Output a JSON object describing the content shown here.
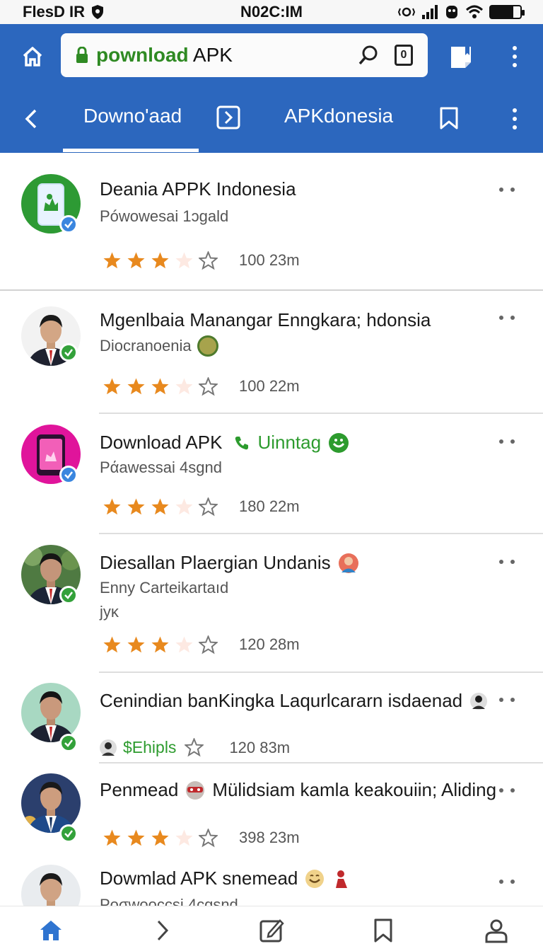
{
  "status_bar": {
    "left_text": "FlesD IR",
    "center_text": "N02C:IM",
    "battery_level": 0.75
  },
  "browser": {
    "url_accent": "pownload",
    "url_rest": " APK",
    "tab_count": "0"
  },
  "tabs": {
    "download_label": "Downo'aad",
    "apk_label": "APKdonesia"
  },
  "colors": {
    "toolbar": "#2c67be",
    "star_filled": "#e8891e",
    "verified_green": "#33a13a",
    "verified_blue": "#3a86df",
    "text_green": "#2d9b2e"
  },
  "items": [
    {
      "title": "Deania APPK Indonesia",
      "subtitle": "Pówowesai 1ɔgald",
      "rating_count": "100 23m",
      "stars": 3
    },
    {
      "title": "Mgenlbaia Manangar Enngkara; hdonsia",
      "subtitle": "Diocranoenia",
      "rating_count": "100 22m",
      "stars": 3
    },
    {
      "title": "Download APK",
      "title_extra": "Uinntag",
      "subtitle": "Pάawessai 4sgnd",
      "rating_count": "180 22m",
      "stars": 3
    },
    {
      "title": "Diesallan Plaergian Undanis",
      "subtitle": "Enny Carteikartaıd",
      "subtitle2": "jyκ",
      "rating_count": "120 28m",
      "stars": 3
    },
    {
      "title": "Cenindian banKingka Laqurlcararn isdaenad",
      "subtitle": "$Ehipls",
      "rating_count": "120 83m",
      "stars": 1
    },
    {
      "title": "Penmead",
      "title_rest": "Mülidsiam kamla keakouiin; Aliding",
      "rating_count": "398 23m",
      "stars": 3
    },
    {
      "title": "Dowmlad APK snemead",
      "subtitle": "Poσwooccsi 4cgsnd"
    }
  ]
}
